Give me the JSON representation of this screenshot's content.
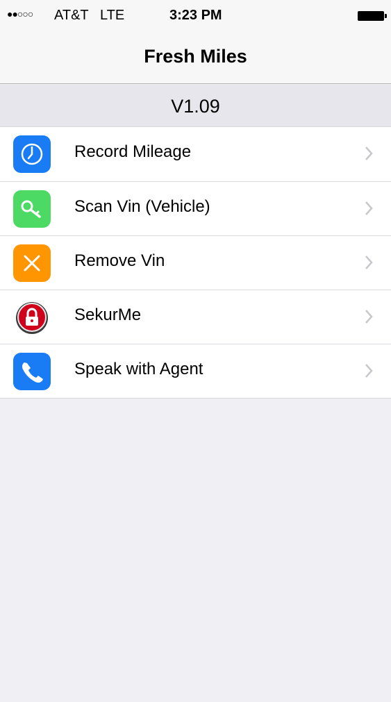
{
  "status_bar": {
    "signal": "●●○○○",
    "carrier": "AT&T",
    "network": "LTE",
    "time": "3:23 PM"
  },
  "nav": {
    "title": "Fresh Miles"
  },
  "version": "V1.09",
  "menu": {
    "items": [
      {
        "label": "Record Mileage",
        "icon": "clock-icon",
        "color": "#1a7cf5"
      },
      {
        "label": "Scan Vin (Vehicle)",
        "icon": "key-icon",
        "color": "#4cd964"
      },
      {
        "label": "Remove Vin",
        "icon": "x-icon",
        "color": "#ff9500"
      },
      {
        "label": "SekurMe",
        "icon": "lock-icon",
        "color": "#d0021b"
      },
      {
        "label": "Speak with Agent",
        "icon": "phone-icon",
        "color": "#1a7cf5"
      }
    ]
  }
}
